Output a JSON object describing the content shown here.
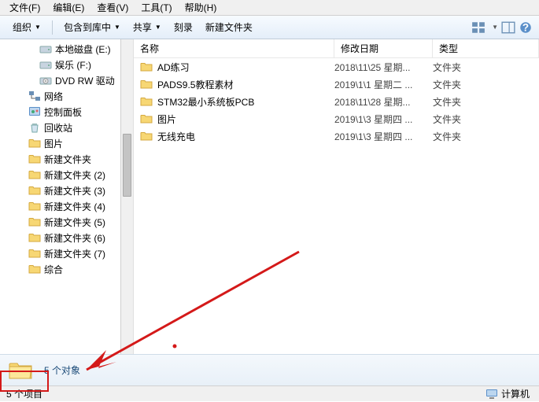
{
  "menus": {
    "file": "文件(F)",
    "edit": "编辑(E)",
    "view": "查看(V)",
    "tools": "工具(T)",
    "help": "帮助(H)"
  },
  "toolbar": {
    "organize": "组织",
    "include_lib": "包含到库中",
    "share": "共享",
    "burn": "刻录",
    "new_folder": "新建文件夹"
  },
  "tree": [
    {
      "label": "本地磁盘 (E:)",
      "icon": "drive",
      "indent": 2
    },
    {
      "label": "娱乐 (F:)",
      "icon": "drive",
      "indent": 2
    },
    {
      "label": "DVD RW 驱动",
      "icon": "dvd",
      "indent": 2
    },
    {
      "label": "网络",
      "icon": "network",
      "indent": 1
    },
    {
      "label": "控制面板",
      "icon": "control",
      "indent": 1
    },
    {
      "label": "回收站",
      "icon": "recycle",
      "indent": 1
    },
    {
      "label": "图片",
      "icon": "folder",
      "indent": 1
    },
    {
      "label": "新建文件夹",
      "icon": "folder",
      "indent": 1
    },
    {
      "label": "新建文件夹 (2)",
      "icon": "folder",
      "indent": 1
    },
    {
      "label": "新建文件夹 (3)",
      "icon": "folder",
      "indent": 1
    },
    {
      "label": "新建文件夹 (4)",
      "icon": "folder",
      "indent": 1
    },
    {
      "label": "新建文件夹 (5)",
      "icon": "folder",
      "indent": 1
    },
    {
      "label": "新建文件夹 (6)",
      "icon": "folder",
      "indent": 1
    },
    {
      "label": "新建文件夹 (7)",
      "icon": "folder",
      "indent": 1
    },
    {
      "label": "综合",
      "icon": "folder",
      "indent": 1
    }
  ],
  "headers": {
    "name": "名称",
    "date": "修改日期",
    "type": "类型"
  },
  "files": [
    {
      "name": "AD练习",
      "date": "2018\\11\\25 星期...",
      "type": "文件夹"
    },
    {
      "name": "PADS9.5教程素材",
      "date": "2019\\1\\1 星期二 ...",
      "type": "文件夹"
    },
    {
      "name": "STM32最小系统板PCB",
      "date": "2018\\11\\28 星期...",
      "type": "文件夹"
    },
    {
      "name": "图片",
      "date": "2019\\1\\3 星期四 ...",
      "type": "文件夹"
    },
    {
      "name": "无线充电",
      "date": "2019\\1\\3 星期四 ...",
      "type": "文件夹"
    }
  ],
  "details": {
    "caption": "5 个对象"
  },
  "status": {
    "left": "5 个项目",
    "right": "计算机"
  }
}
